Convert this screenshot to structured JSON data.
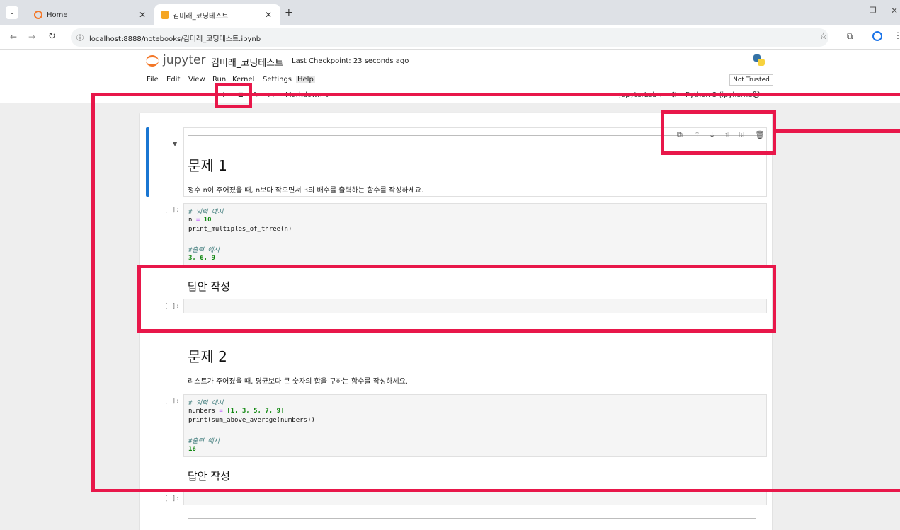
{
  "browser": {
    "tabs": [
      {
        "label": "Home",
        "active": false
      },
      {
        "label": "김미래_코딩테스트",
        "active": true
      }
    ],
    "url": "localhost:8888/notebooks/김미래_코딩테스트.ipynb"
  },
  "jupyter": {
    "logo_text": "jupyter",
    "notebook_title": "김미래_코딩테스트",
    "checkpoint": "Last Checkpoint: 23 seconds ago",
    "trust_status": "Not Trusted",
    "menu": [
      "File",
      "Edit",
      "View",
      "Run",
      "Kernel",
      "Settings",
      "Help"
    ],
    "cell_type": "Markdown",
    "jupyterlab_label": "JupyterLab",
    "kernel": "Python 3 (ipykernel)"
  },
  "cells": {
    "q1_title": "문제 1",
    "q1_desc": "정수 n이 주어졌을 때, n보다 작으면서 3의 배수를 출력하는 함수를 작성하세요.",
    "prompt": "[ ]:",
    "q1_code": {
      "l1": "# 입력 예시",
      "l2a": "n ",
      "l2b": "=",
      "l2c": " 10",
      "l3": "print_multiples_of_three(n)",
      "l4": "#출력 예시",
      "l5": "3, 6, 9"
    },
    "answer_heading": "답안 작성",
    "q2_title": "문제 2",
    "q2_desc": "리스트가 주어졌을 때, 평균보다 큰 숫자의 합을 구하는 함수를 작성하세요.",
    "q2_code": {
      "l1": "# 입력 예시",
      "l2a": "numbers ",
      "l2b": "=",
      "l2c": " [1, 3, 5, 7, 9]",
      "l3": "print(sum_above_average(numbers))",
      "l4": "#출력 예시",
      "l5": "16"
    }
  },
  "colors": {
    "annotation_red": "#e8174a",
    "active_cell_bar": "#1976d2"
  }
}
